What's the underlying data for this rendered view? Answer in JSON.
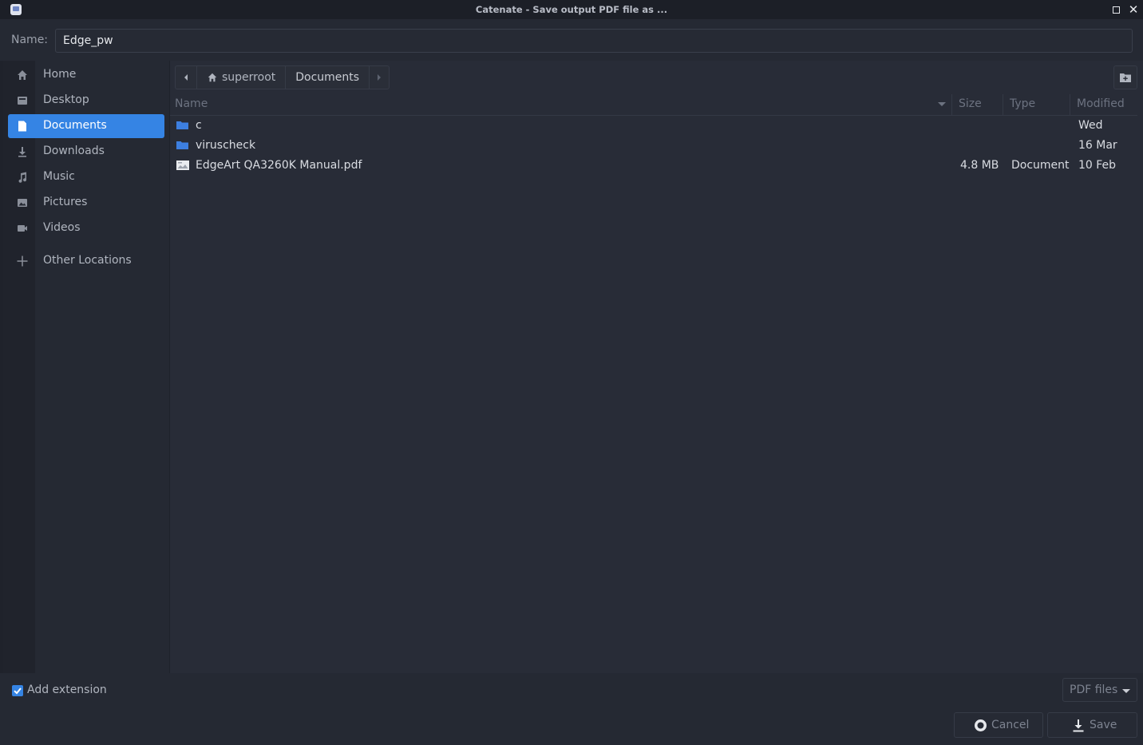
{
  "window": {
    "title": "Catenate - Save output PDF file as ...",
    "maximize_icon": "maximize-icon",
    "close_icon": "close-icon"
  },
  "name_field": {
    "label": "Name:",
    "value": "Edge_pw"
  },
  "sidebar": {
    "items": [
      {
        "label": "Home",
        "icon": "home-icon",
        "active": false
      },
      {
        "label": "Desktop",
        "icon": "desktop-icon",
        "active": false
      },
      {
        "label": "Documents",
        "icon": "document-icon",
        "active": true
      },
      {
        "label": "Downloads",
        "icon": "download-icon",
        "active": false
      },
      {
        "label": "Music",
        "icon": "music-icon",
        "active": false
      },
      {
        "label": "Pictures",
        "icon": "picture-icon",
        "active": false
      },
      {
        "label": "Videos",
        "icon": "video-icon",
        "active": false
      },
      {
        "label": "Other Locations",
        "icon": "plus-icon",
        "active": false
      }
    ]
  },
  "pathbar": {
    "segments": [
      "superroot",
      "Documents"
    ],
    "home_icon": "home-icon"
  },
  "columns": {
    "name": "Name",
    "size": "Size",
    "type": "Type",
    "modified": "Modified"
  },
  "files": [
    {
      "name": "c",
      "size": "",
      "type": "",
      "modified": "Wed",
      "icon": "folder-icon"
    },
    {
      "name": "viruscheck",
      "size": "",
      "type": "",
      "modified": "16 Mar",
      "icon": "folder-icon"
    },
    {
      "name": "EdgeArt QA3260K Manual.pdf",
      "size": "4.8 MB",
      "type": "Document",
      "modified": "10 Feb",
      "icon": "pdf-file-icon"
    }
  ],
  "footer": {
    "add_extension_label": "Add extension",
    "add_extension_checked": true,
    "filter_label": "PDF files",
    "cancel_label": "Cancel",
    "save_label": "Save"
  },
  "colors": {
    "accent": "#3584e4",
    "folder": "#3d7fe0",
    "background": "#282c37"
  }
}
